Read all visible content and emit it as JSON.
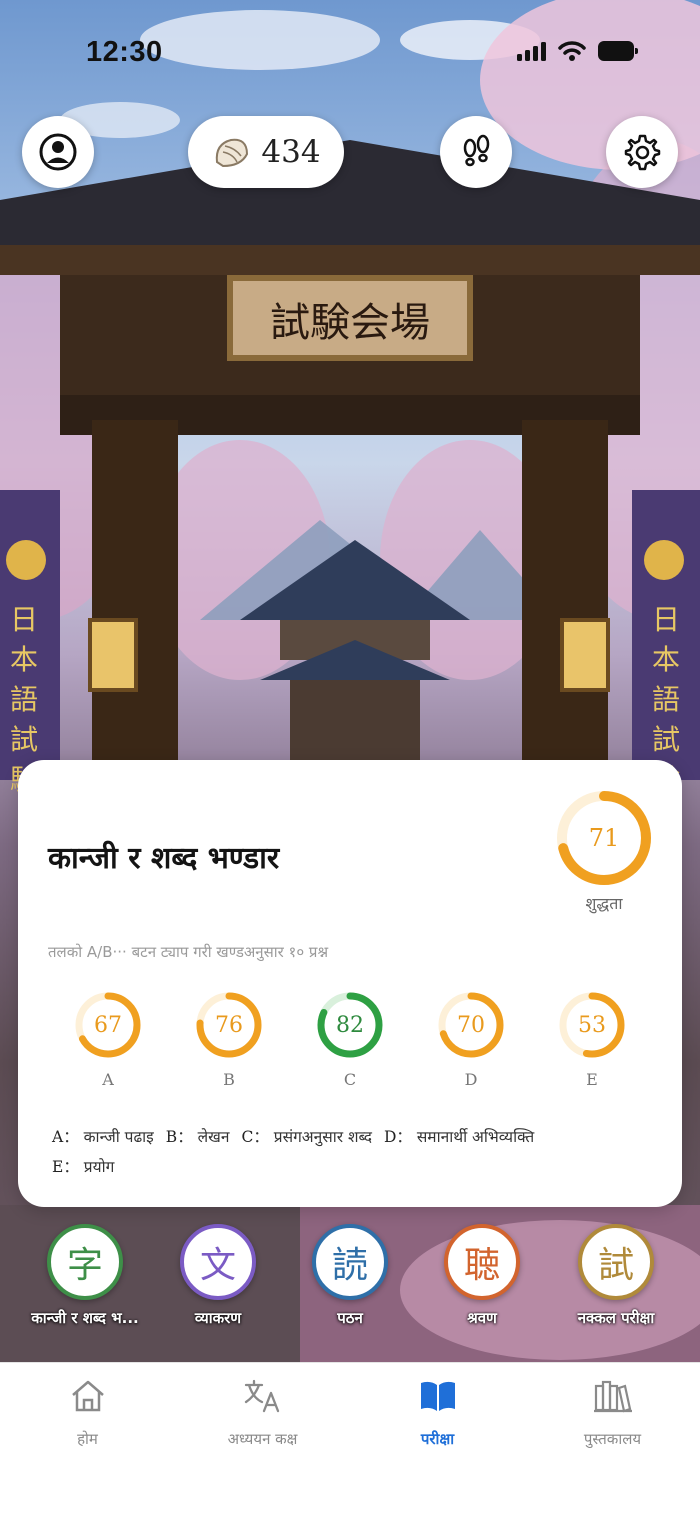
{
  "status_bar": {
    "time": "12:30"
  },
  "header": {
    "coins": "434"
  },
  "scene": {
    "gate_sign": "試験会場",
    "banner_text": "日本語試験"
  },
  "card": {
    "title": "कान्जी र शब्द भण्डार",
    "accuracy": {
      "value": 71,
      "label": "शुद्धता"
    },
    "hint": "तलको A/B··· बटन ट्याप गरी खण्डअनुसार १० प्रश्न",
    "sections": [
      {
        "key": "A",
        "value": 67
      },
      {
        "key": "B",
        "value": 76
      },
      {
        "key": "C",
        "value": 82
      },
      {
        "key": "D",
        "value": 70
      },
      {
        "key": "E",
        "value": 53
      }
    ],
    "legend": [
      {
        "key": "A",
        "sep": "：",
        "text": "कान्जी पढाइ"
      },
      {
        "key": "B",
        "sep": "：",
        "text": "लेखन"
      },
      {
        "key": "C",
        "sep": "：",
        "text": "प्रसंगअनुसार शब्द"
      },
      {
        "key": "D",
        "sep": "：",
        "text": "समानार्थी अभिव्यक्ति"
      },
      {
        "key": "E",
        "sep": "：",
        "text": "प्रयोग"
      }
    ]
  },
  "categories": [
    {
      "char": "字",
      "label": "कान्जी र शब्द भ...",
      "color": "#3e8f48"
    },
    {
      "char": "文",
      "label": "व्याकरण",
      "color": "#7b5bc4"
    },
    {
      "char": "読",
      "label": "पठन",
      "color": "#2f6fa8"
    },
    {
      "char": "聴",
      "label": "श्रवण",
      "color": "#d2642e"
    },
    {
      "char": "試",
      "label": "नक्कल परीक्षा",
      "color": "#b08a3a"
    }
  ],
  "nav": [
    {
      "label": "होम",
      "icon": "home-icon",
      "active": false
    },
    {
      "label": "अध्ययन कक्ष",
      "icon": "translate-icon",
      "active": false
    },
    {
      "label": "परीक्षा",
      "icon": "book-icon",
      "active": true
    },
    {
      "label": "पुस्तकालय",
      "icon": "library-icon",
      "active": false
    }
  ],
  "colors": {
    "accent": "#1f6fd8",
    "ring_orange": "#f0a020",
    "ring_green": "#2ea043"
  }
}
